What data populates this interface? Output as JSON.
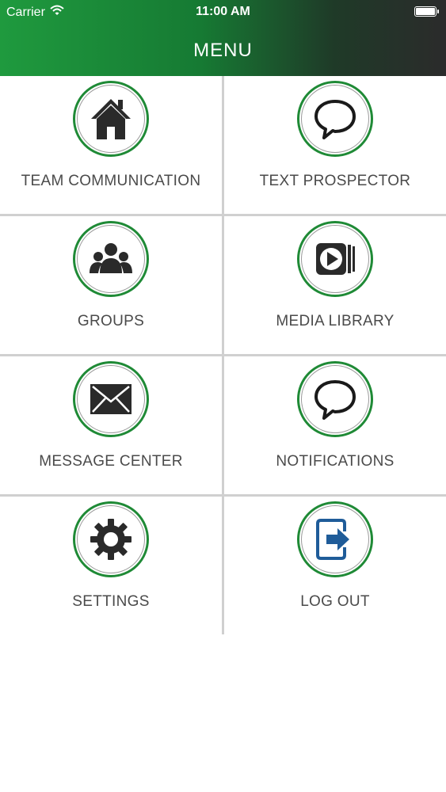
{
  "status_bar": {
    "carrier": "Carrier",
    "time": "11:00 AM",
    "battery_level": 1.0
  },
  "nav": {
    "title": "MENU"
  },
  "colors": {
    "header_start": "#1f9a3e",
    "header_end": "#2b2b2b",
    "ring": "#1f8a36",
    "logout_accent": "#1f5c99"
  },
  "menu": {
    "items": [
      {
        "label": "TEAM COMMUNICATION",
        "icon": "home-icon"
      },
      {
        "label": "TEXT PROSPECTOR",
        "icon": "speech-bubble-icon"
      },
      {
        "label": "GROUPS",
        "icon": "group-icon"
      },
      {
        "label": "MEDIA LIBRARY",
        "icon": "media-play-icon"
      },
      {
        "label": "MESSAGE CENTER",
        "icon": "envelope-icon"
      },
      {
        "label": "NOTIFICATIONS",
        "icon": "speech-bubble-icon"
      },
      {
        "label": "SETTINGS",
        "icon": "gear-icon"
      },
      {
        "label": "LOG OUT",
        "icon": "logout-icon"
      }
    ]
  }
}
